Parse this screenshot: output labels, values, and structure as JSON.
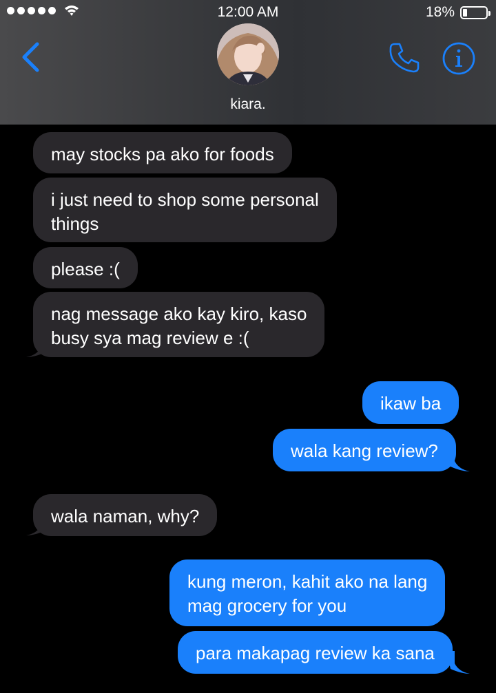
{
  "status_bar": {
    "signal_dots": 5,
    "time": "12:00 AM",
    "battery": "18%",
    "battery_level": 0.18
  },
  "header": {
    "contact_name": "kiara.",
    "back_icon": "chevron-left-icon",
    "call_icon": "phone-icon",
    "info_icon": "info-icon",
    "accent_color": "#1a80fb"
  },
  "messages": [
    {
      "direction": "incoming",
      "lines": [
        "may stocks pa ako for foods"
      ]
    },
    {
      "direction": "incoming",
      "lines": [
        "i just need to shop some personal",
        "things"
      ]
    },
    {
      "direction": "incoming",
      "lines": [
        "please :("
      ]
    },
    {
      "direction": "incoming",
      "lines": [
        "nag message ako kay kiro, kaso",
        "busy sya mag review e :("
      ]
    },
    {
      "direction": "outgoing",
      "lines": [
        "ikaw ba"
      ]
    },
    {
      "direction": "outgoing",
      "lines": [
        "wala kang review?"
      ]
    },
    {
      "direction": "incoming",
      "lines": [
        "wala naman, why?"
      ]
    },
    {
      "direction": "outgoing",
      "lines": [
        "kung meron, kahit ako na lang",
        "mag grocery for you"
      ]
    },
    {
      "direction": "outgoing",
      "lines": [
        "para makapag review ka sana"
      ]
    }
  ],
  "colors": {
    "incoming_bubble": "#2a282c",
    "outgoing_bubble": "#1a80fb",
    "background": "#000000"
  }
}
